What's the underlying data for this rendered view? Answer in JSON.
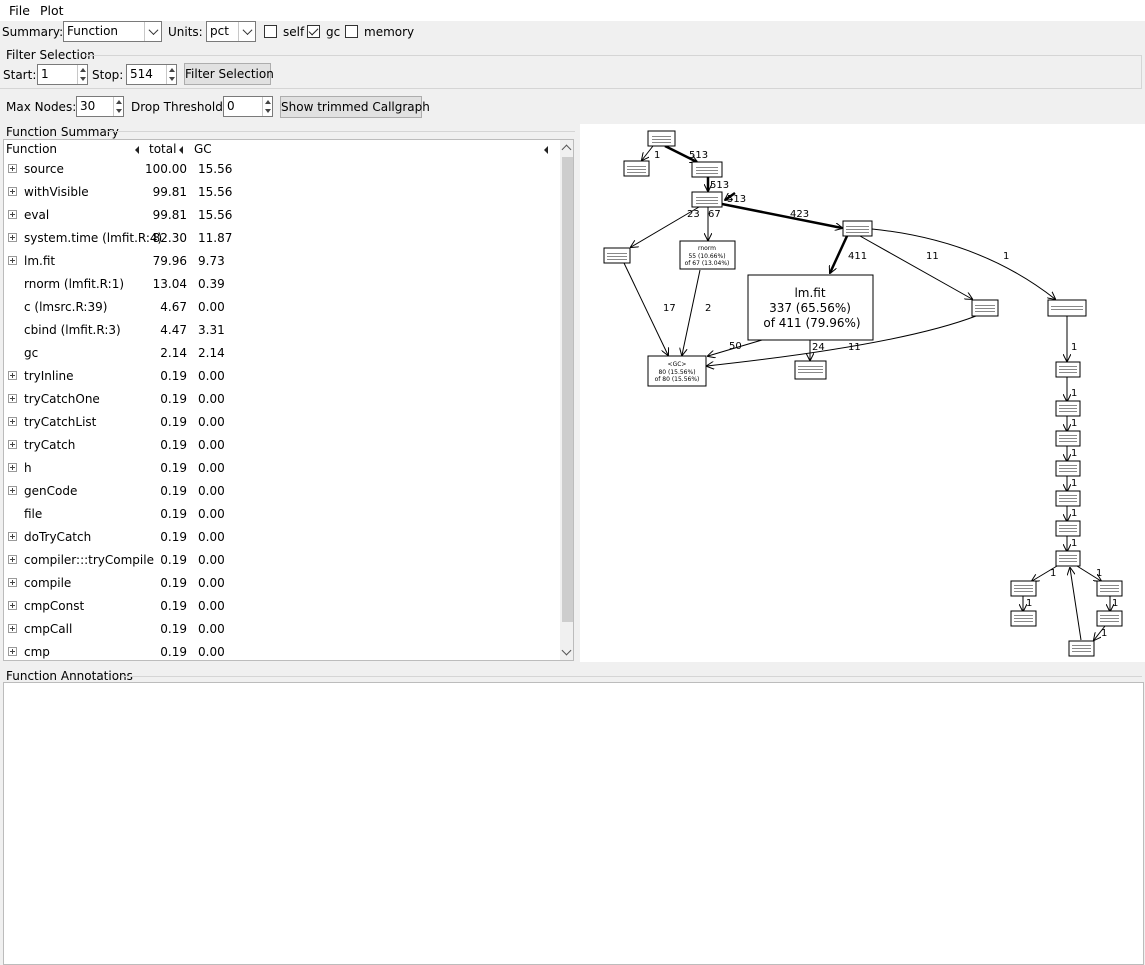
{
  "menu": {
    "file": "File",
    "plot": "Plot"
  },
  "toolbar": {
    "summary_label": "Summary:",
    "summary_value": "Function",
    "units_label": "Units:",
    "units_value": "pct",
    "self_label": "self",
    "self_checked": false,
    "gc_label": "gc",
    "gc_checked": true,
    "memory_label": "memory",
    "memory_checked": false
  },
  "filter": {
    "title": "Filter Selection",
    "start_label": "Start:",
    "start_value": "1",
    "stop_label": "Stop:",
    "stop_value": "514",
    "button": "Filter Selection"
  },
  "nodes": {
    "max_label": "Max Nodes:",
    "max_value": "30",
    "drop_label": "Drop Threshold:",
    "drop_value": "0",
    "button": "Show trimmed Callgraph"
  },
  "summary": {
    "title": "Function Summary",
    "columns": [
      "Function",
      "total",
      "GC"
    ],
    "rows": [
      {
        "name": "source",
        "total": "100.00",
        "gc": "15.56",
        "expandable": true
      },
      {
        "name": "withVisible",
        "total": "99.81",
        "gc": "15.56",
        "expandable": true
      },
      {
        "name": "eval",
        "total": "99.81",
        "gc": "15.56",
        "expandable": true
      },
      {
        "name": "system.time (lmfit.R:4)",
        "total": "82.30",
        "gc": "11.87",
        "expandable": true
      },
      {
        "name": "lm.fit",
        "total": "79.96",
        "gc": "9.73",
        "expandable": true
      },
      {
        "name": "rnorm (lmfit.R:1)",
        "total": "13.04",
        "gc": "0.39",
        "expandable": false
      },
      {
        "name": "c (lmsrc.R:39)",
        "total": "4.67",
        "gc": "0.00",
        "expandable": false
      },
      {
        "name": "cbind (lmfit.R:3)",
        "total": "4.47",
        "gc": "3.31",
        "expandable": false
      },
      {
        "name": "gc",
        "total": "2.14",
        "gc": "2.14",
        "expandable": false
      },
      {
        "name": "tryInline",
        "total": "0.19",
        "gc": "0.00",
        "expandable": true
      },
      {
        "name": "tryCatchOne",
        "total": "0.19",
        "gc": "0.00",
        "expandable": true
      },
      {
        "name": "tryCatchList",
        "total": "0.19",
        "gc": "0.00",
        "expandable": true
      },
      {
        "name": "tryCatch",
        "total": "0.19",
        "gc": "0.00",
        "expandable": true
      },
      {
        "name": "h",
        "total": "0.19",
        "gc": "0.00",
        "expandable": true
      },
      {
        "name": "genCode",
        "total": "0.19",
        "gc": "0.00",
        "expandable": true
      },
      {
        "name": "file",
        "total": "0.19",
        "gc": "0.00",
        "expandable": false
      },
      {
        "name": "doTryCatch",
        "total": "0.19",
        "gc": "0.00",
        "expandable": true
      },
      {
        "name": "compiler:::tryCompile",
        "total": "0.19",
        "gc": "0.00",
        "expandable": true
      },
      {
        "name": "compile",
        "total": "0.19",
        "gc": "0.00",
        "expandable": true
      },
      {
        "name": "cmpConst",
        "total": "0.19",
        "gc": "0.00",
        "expandable": true
      },
      {
        "name": "cmpCall",
        "total": "0.19",
        "gc": "0.00",
        "expandable": true
      },
      {
        "name": "cmp",
        "total": "0.19",
        "gc": "0.00",
        "expandable": true
      }
    ]
  },
  "graph": {
    "edge_labels": [
      "1",
      "513",
      "513",
      "513",
      "23",
      "67",
      "423",
      "411",
      "11",
      "1",
      "17",
      "2",
      "50",
      "24",
      "11",
      "1",
      "1",
      "1",
      "1",
      "1",
      "1",
      "1",
      "1",
      "1",
      "1",
      "1",
      "1"
    ],
    "lmfit_node": {
      "line1": "lm.fit",
      "line2": "337 (65.56%)",
      "line3": "of 411 (79.96%)"
    },
    "rnorm_node": {
      "line1": "rnorm",
      "line2": "55 (10.66%)",
      "line3": "of 67 (13.04%)"
    },
    "gc_node": {
      "line1": "<GC>",
      "line2": "80 (15.56%)",
      "line3": "of 80 (15.56%)"
    }
  },
  "annotations": {
    "title": "Function Annotations"
  }
}
